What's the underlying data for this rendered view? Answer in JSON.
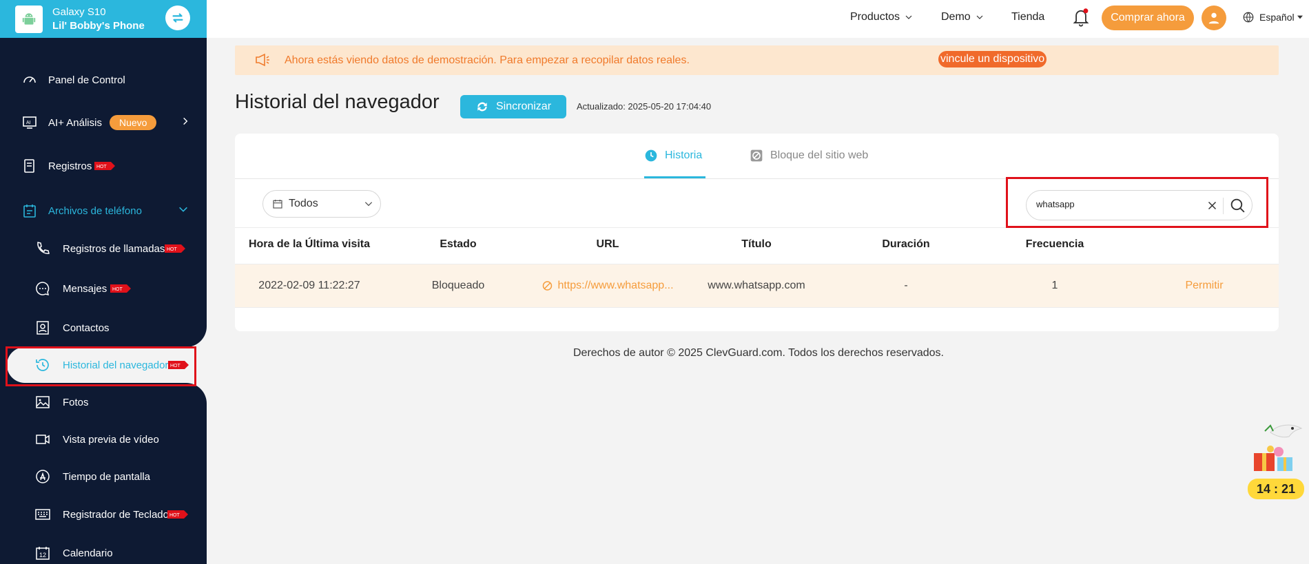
{
  "device": {
    "model": "Galaxy S10",
    "name": "Lil' Bobby's Phone"
  },
  "sidebar": {
    "items": [
      {
        "label": "Panel de Control",
        "icon": "dashboard-icon"
      },
      {
        "label": "AI+ Análisis",
        "icon": "ai-icon",
        "badge": "Nuevo"
      },
      {
        "label": "Registros",
        "icon": "records-icon",
        "hot": "HOT"
      },
      {
        "label": "Archivos de teléfono",
        "icon": "phone-files-icon"
      },
      {
        "label": "Registros de llamadas",
        "icon": "phone-icon",
        "hot": "HOT"
      },
      {
        "label": "Mensajes",
        "icon": "message-icon",
        "hot": "HOT"
      },
      {
        "label": "Contactos",
        "icon": "contacts-icon"
      },
      {
        "label": "Historial del navegador",
        "icon": "history-icon",
        "hot": "HOT"
      },
      {
        "label": "Fotos",
        "icon": "photo-icon"
      },
      {
        "label": "Vista previa de vídeo",
        "icon": "video-icon"
      },
      {
        "label": "Tiempo de pantalla",
        "icon": "app-store-icon"
      },
      {
        "label": "Registrador de Teclado",
        "icon": "keyboard-icon",
        "hot": "HOT"
      },
      {
        "label": "Calendario",
        "icon": "calendar-icon"
      }
    ]
  },
  "topbar": {
    "products": "Productos",
    "demo": "Demo",
    "store": "Tienda",
    "buy": "Comprar ahora",
    "language": "Español"
  },
  "banner": {
    "text": "Ahora estás viendo datos de demostración. Para empezar a recopilar datos reales.",
    "link": "vincule un dispositivo"
  },
  "page": {
    "title": "Historial del navegador",
    "sync": "Sincronizar",
    "updated": "Actualizado: 2025-05-20 17:04:40"
  },
  "tabs": {
    "history": "Historia",
    "block": "Bloque del sitio web"
  },
  "filter": {
    "value": "Todos"
  },
  "search": {
    "value": "whatsapp"
  },
  "table": {
    "headers": [
      "Hora de la Última visita",
      "Estado",
      "URL",
      "Título",
      "Duración",
      "Frecuencia"
    ],
    "rows": [
      {
        "time": "2022-02-09 11:22:27",
        "status": "Bloqueado",
        "url": "https://www.whatsapp...",
        "title": "www.whatsapp.com",
        "duration": "-",
        "frequency": "1",
        "action": "Permitir"
      }
    ]
  },
  "footer": "Derechos de autor © 2025 ClevGuard.com. Todos los derechos reservados.",
  "timer": "14 : 21",
  "colors": {
    "accent": "#2bb7dd",
    "orange": "#f59c3c",
    "sidebar": "#0e1a33",
    "highlight": "#e0111a"
  }
}
